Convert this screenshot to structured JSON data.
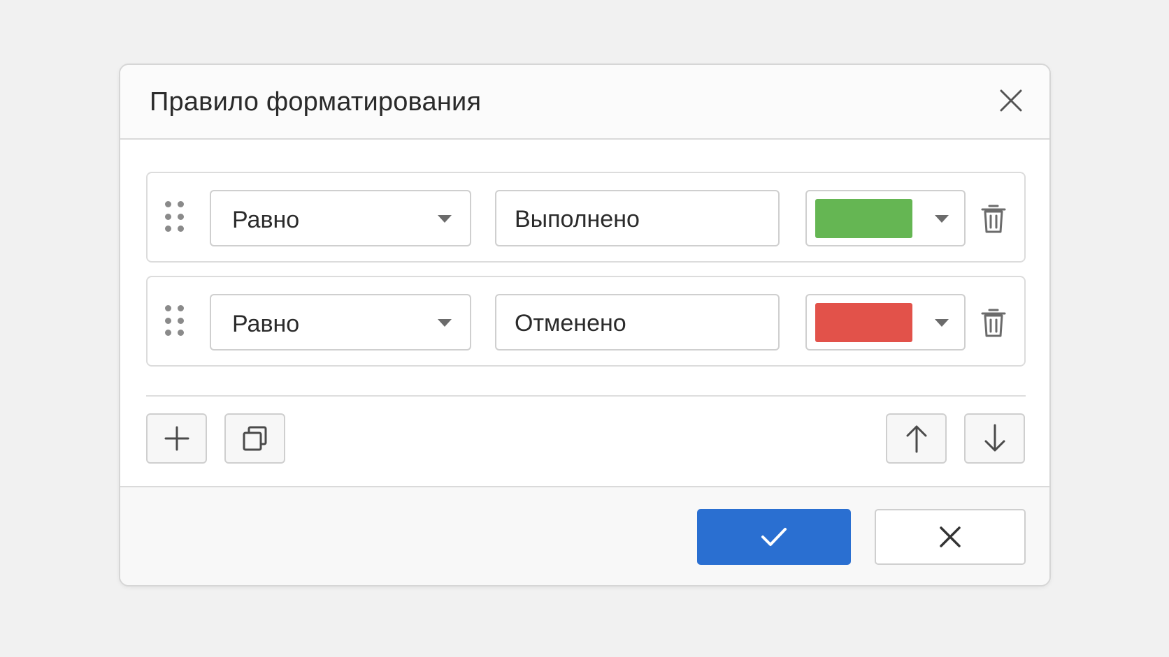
{
  "dialog": {
    "title": "Правило форматирования"
  },
  "rules": [
    {
      "condition": "Равно",
      "value": "Выполнено",
      "color": "#65b653",
      "color_name": "green"
    },
    {
      "condition": "Равно",
      "value": "Отменено",
      "color": "#e2524a",
      "color_name": "red"
    }
  ],
  "toolbar": {
    "add_icon": "plus-icon",
    "duplicate_icon": "copy-icon",
    "move_up_icon": "arrow-up-icon",
    "move_down_icon": "arrow-down-icon"
  },
  "footer": {
    "confirm_icon": "check-icon",
    "cancel_icon": "close-icon"
  },
  "colors": {
    "accent": "#2a6fd1",
    "background": "#f1f1f1"
  }
}
